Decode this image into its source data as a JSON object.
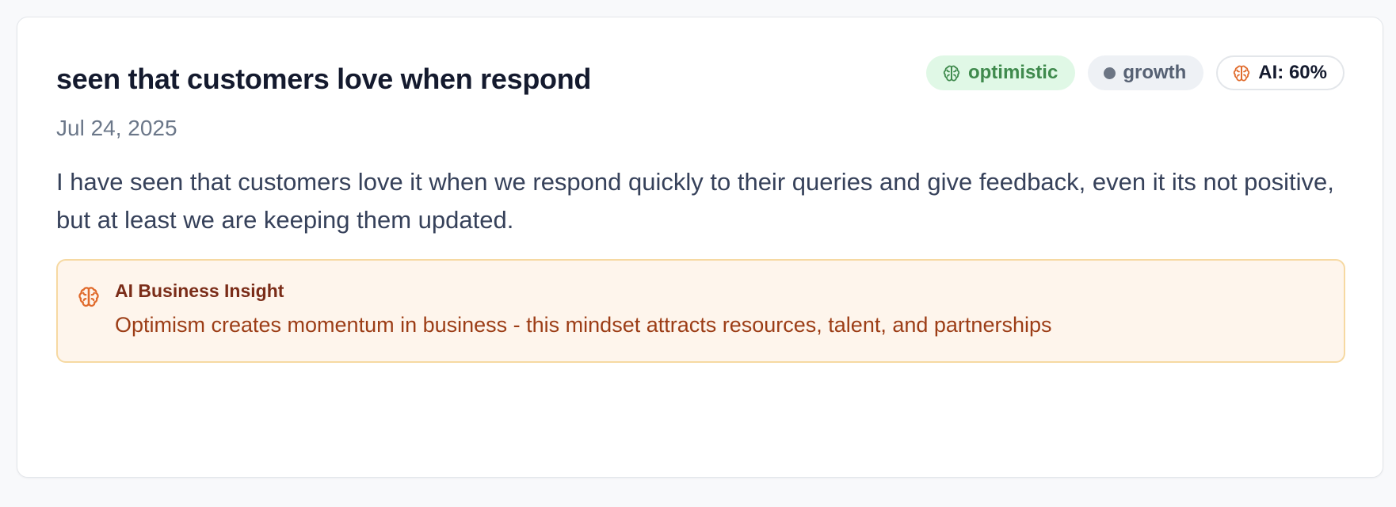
{
  "card": {
    "title": "seen that customers love when respond",
    "date": "Jul 24, 2025",
    "body": "I have seen that customers love it when we respond quickly to their queries and give feedback, even it its not positive, but at least we are keeping them updated.",
    "badges": {
      "sentiment": {
        "label": "optimistic",
        "icon": "brain-icon",
        "color": "#3f8a4d",
        "background": "#e0f8e6"
      },
      "topic": {
        "label": "growth",
        "color": "#566173",
        "background": "#eef1f5"
      },
      "ai": {
        "label": "AI: 60%",
        "icon": "brain-icon",
        "icon_color": "#e06a2b"
      }
    },
    "insight": {
      "heading": "AI Business Insight",
      "text": "Optimism creates momentum in business - this mindset attracts resources, talent, and partnerships",
      "icon": "brain-icon",
      "icon_color": "#e06a2b",
      "background": "#fef5ec",
      "border": "#f6d9a2"
    }
  }
}
